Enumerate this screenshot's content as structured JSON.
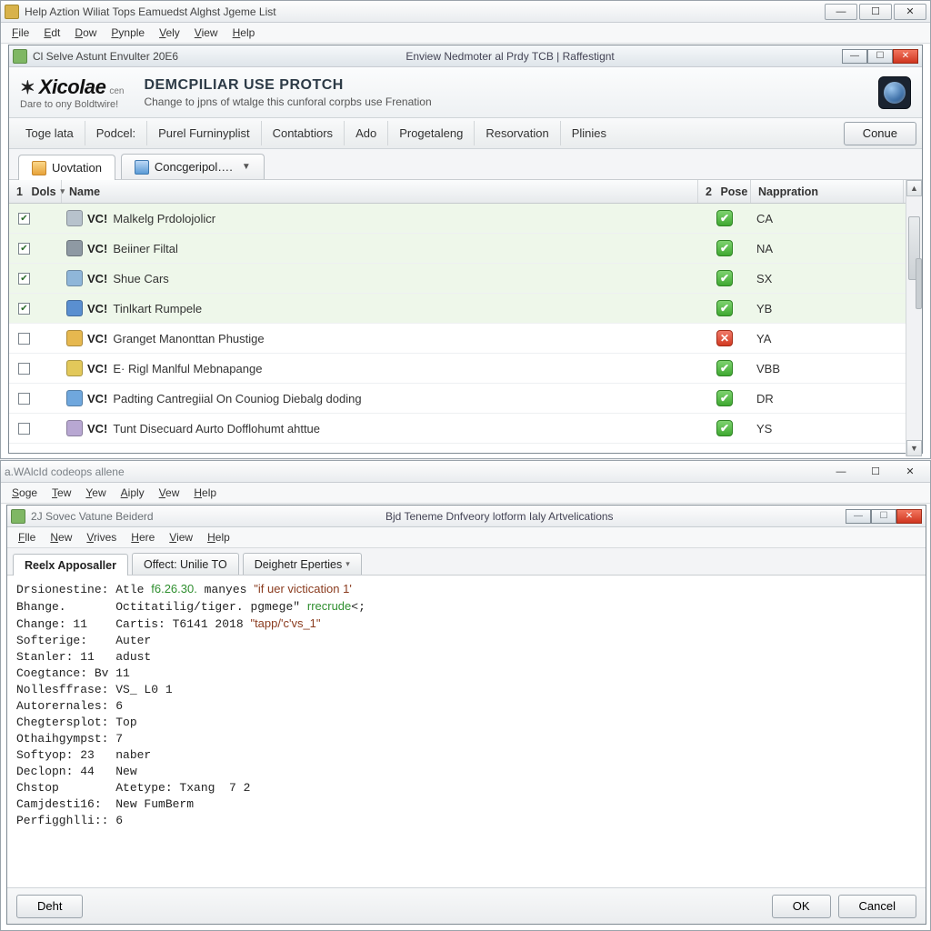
{
  "top": {
    "outer_title": "Help Aztion Wiliat Tops Eamuedst Alghst Jgeme List",
    "outer_menu": [
      "File",
      "Edt",
      "Dow",
      "Pynple",
      "Vely",
      "View",
      "Help"
    ],
    "inner_title_left": "Cl Selve Astunt Envulter 20E6",
    "inner_title_center": "Enview Nedmoter al Prdy TCB | Raffestignt",
    "banner": {
      "logo": "Xicolae",
      "logo_sub": "cen",
      "tagline": "Dare to ony Boldtwire!",
      "title": "DEMCPILIAR USE PROTCH",
      "desc": "Change to jpns of wtalge this cunforal corpbs use Frenation"
    },
    "navtabs": [
      "Toge lata",
      "Podcel:",
      "Purel Furninyplist",
      "Contabtiors",
      "Ado",
      "Progetaleng",
      "Resorvation",
      "Plinies"
    ],
    "continue_btn": "Conue",
    "subtabs": [
      {
        "label": "Uovtation",
        "icon": "ico-orange",
        "active": true,
        "dropdown": false
      },
      {
        "label": "Concgeripol….",
        "icon": "ico-blue",
        "active": false,
        "dropdown": true
      }
    ],
    "grid_headers": {
      "dols": "Dols",
      "name": "Name",
      "pose": "Pose",
      "napp": "Nappration",
      "dols_n": "1",
      "pose_n": "2"
    },
    "rows": [
      {
        "checked": true,
        "sel": true,
        "icon": "#b7c2cc",
        "vc": "VC!",
        "desc": "Malkelg Prdolojolicr",
        "status": "ok",
        "napp": "CA"
      },
      {
        "checked": true,
        "sel": true,
        "icon": "#8e99a3",
        "vc": "VC!",
        "desc": "Beiiner Filtal",
        "status": "ok",
        "napp": "NA"
      },
      {
        "checked": true,
        "sel": true,
        "icon": "#8fb6d9",
        "vc": "VC!",
        "desc": "Shue Cars",
        "status": "ok",
        "napp": "SX"
      },
      {
        "checked": true,
        "sel": true,
        "icon": "#5a8fd0",
        "vc": "VC!",
        "desc": "Tinlkart Rumpele",
        "status": "ok",
        "napp": "YB"
      },
      {
        "checked": false,
        "sel": false,
        "icon": "#e6b84f",
        "vc": "VC!",
        "desc": "Granget Manonttan Phustige",
        "status": "bad",
        "napp": "YA"
      },
      {
        "checked": false,
        "sel": false,
        "icon": "#e2c85a",
        "vc": "VC!",
        "desc": "E· Rigl Manlful Mebnapange",
        "status": "ok",
        "napp": "VBB"
      },
      {
        "checked": false,
        "sel": false,
        "icon": "#6fa7dd",
        "vc": "VC!",
        "desc": "Padting Cantregiial On Couniog Diebalg doding",
        "status": "ok",
        "napp": "DR"
      },
      {
        "checked": false,
        "sel": false,
        "icon": "#b8a7d2",
        "vc": "VC!",
        "desc": "Tunt Disecuard Aurto Dofflohumt ahttue",
        "status": "ok",
        "napp": "YS"
      }
    ]
  },
  "bot": {
    "outer_title": "a.WAlcId codeops allene",
    "outer_menu": [
      "Soge",
      "Tew",
      "Yew",
      "Aiply",
      "Vew",
      "Help"
    ],
    "inner_title_left": "2J Sovec Vatune Beiderd",
    "inner_title_center": "Bjd Teneme Dnfveory lotform Ialy Artvelications",
    "inner_menu": [
      "Flle",
      "New",
      "Vrives",
      "Here",
      "View",
      "Help"
    ],
    "tabs": [
      {
        "label": "Reelx Apposaller",
        "active": true,
        "dropdown": false
      },
      {
        "label": "Offect: Unilie TO",
        "active": false,
        "dropdown": false
      },
      {
        "label": "Deighetr Eperties",
        "active": false,
        "dropdown": true
      }
    ],
    "console_lines": [
      {
        "k": "Drsionestine:",
        "v": "Atle ",
        "kw": "f6.26.30.",
        "v2": " manyes ",
        "str": "\"if uer victication 1'"
      },
      {
        "k": "Bhange.",
        "v": "Octitatilig/tiger. pgmege\" ",
        "kw": "rrecrude",
        "v2": "<;"
      },
      {
        "k": "Change: 11",
        "v": "Cartis: T6141 2018 ",
        "str": "\"tapp/'c'vs_1\""
      },
      {
        "k": "Softerige:",
        "v": "Auter"
      },
      {
        "k": "Stanler: 11",
        "v": "adust"
      },
      {
        "k": "Coegtance: Bv",
        "v": "11"
      },
      {
        "k": "Nollesffrase:",
        "v": "VS_ L0 1"
      },
      {
        "k": "Autorernales:",
        "v": "6"
      },
      {
        "k": "Chegtersplot:",
        "v": "Top"
      },
      {
        "k": "Othaihgympst:",
        "v": "7"
      },
      {
        "k": "Softyop: 23",
        "v": "naber"
      },
      {
        "k": "Declopn: 44",
        "v": "New"
      },
      {
        "k": "Chstop",
        "v": "Atetype: Txang  7 2"
      },
      {
        "k": "Camjdesti16:",
        "v": "New FumBerm"
      },
      {
        "k": "Perfigghlli::",
        "v": "6"
      }
    ],
    "footer": {
      "left": "Deht",
      "ok": "OK",
      "cancel": "Cancel"
    }
  }
}
